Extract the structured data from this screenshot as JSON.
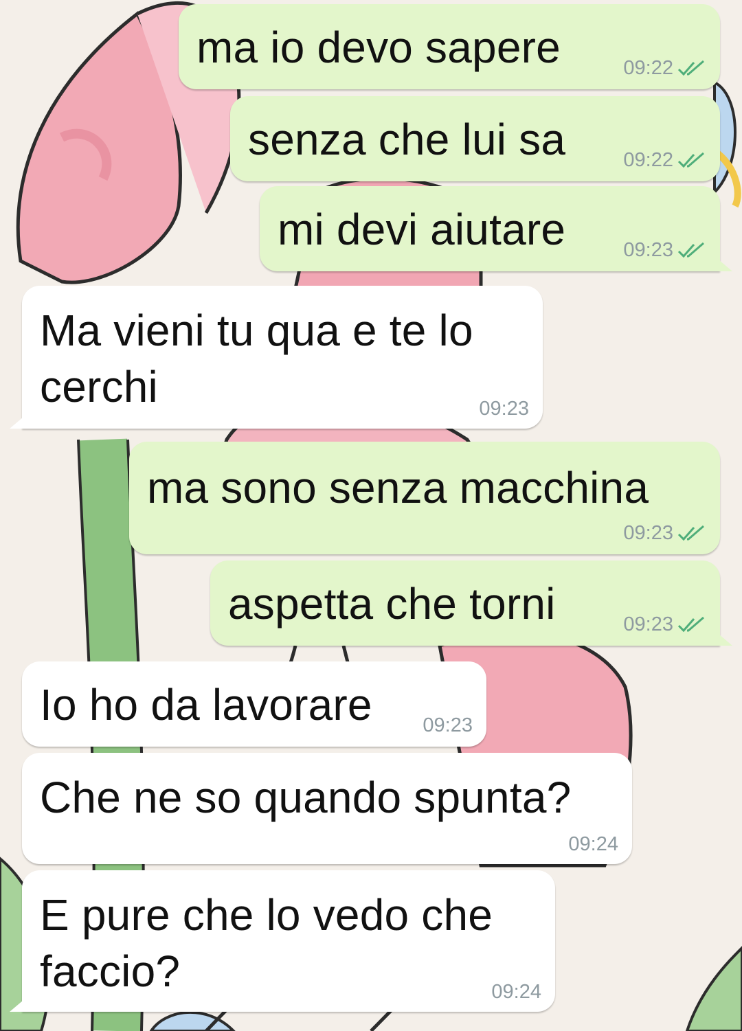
{
  "messages": [
    {
      "direction": "out",
      "text": "ma io devo sapere",
      "time": "09:22",
      "status": "read-icon"
    },
    {
      "direction": "out",
      "text": "senza che lui sa",
      "time": "09:22",
      "status": "read-icon"
    },
    {
      "direction": "out",
      "text": "mi devi aiutare",
      "time": "09:23",
      "status": "read-icon"
    },
    {
      "direction": "in",
      "text": "Ma vieni tu qua e te lo cerchi",
      "time": "09:23"
    },
    {
      "direction": "out",
      "text": "ma sono senza macchina",
      "time": "09:23",
      "status": "read-icon"
    },
    {
      "direction": "out",
      "text": "aspetta che torni",
      "time": "09:23",
      "status": "read-icon"
    },
    {
      "direction": "in",
      "text": "Io ho da lavorare",
      "time": "09:23"
    },
    {
      "direction": "in",
      "text": "Che ne so quando spunta?",
      "time": "09:24"
    },
    {
      "direction": "in",
      "text": "E pure che lo vedo che faccio?",
      "time": "09:24"
    }
  ],
  "colors": {
    "outgoing_bubble": "#e3f6cb",
    "incoming_bubble": "#ffffff",
    "timestamp": "#8e9aa0",
    "read_ticks": "#4fae7a"
  }
}
